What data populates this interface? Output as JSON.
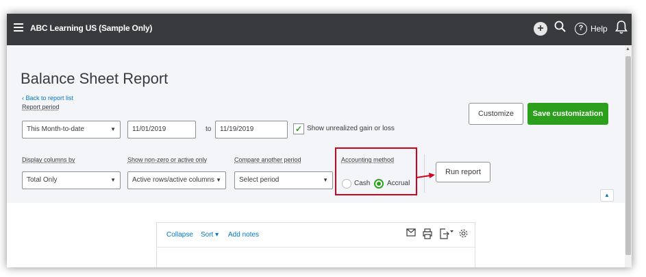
{
  "topbar": {
    "company": "ABC Learning US (Sample Only)",
    "help_label": "Help",
    "icons": [
      "menu-icon",
      "plus-icon",
      "search-icon",
      "help-icon",
      "bell-icon"
    ]
  },
  "header": {
    "title": "Balance Sheet Report",
    "back_link": "Back to report list",
    "report_period_label": "Report period"
  },
  "period": {
    "selected": "This Month-to-date",
    "from": "11/01/2019",
    "to_label": "to",
    "to": "11/19/2019",
    "unrealized_label": "Show unrealized gain or loss",
    "unrealized_checked": true
  },
  "actions": {
    "customize": "Customize",
    "save": "Save customization",
    "run": "Run report"
  },
  "options": {
    "display_columns_label": "Display columns by",
    "display_columns_value": "Total Only",
    "nonzero_label": "Show non-zero or active only",
    "nonzero_value": "Active rows/active columns",
    "compare_label": "Compare another period",
    "compare_value": "Select period",
    "accounting_label": "Accounting method",
    "cash_label": "Cash",
    "accrual_label": "Accrual",
    "selected_method": "Accrual"
  },
  "report_toolbar": {
    "collapse": "Collapse",
    "sort": "Sort",
    "add_notes": "Add notes"
  },
  "colors": {
    "topbar": "#393a3d",
    "accent_green": "#2ca01c",
    "link_blue": "#0077c5",
    "highlight_red": "#d0021b"
  }
}
